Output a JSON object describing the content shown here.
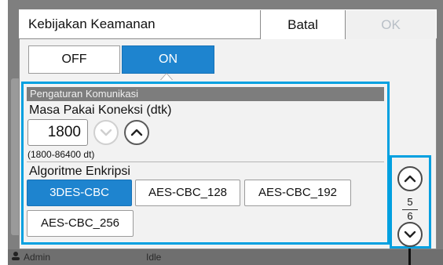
{
  "colors": {
    "accent": "#1e84cf",
    "highlight": "#00a0e0",
    "dim": "#7f7f7f"
  },
  "background": {
    "user": "Admin",
    "status": "Idle"
  },
  "dialog": {
    "title": "Kebijakan Keamanan",
    "cancel_label": "Batal",
    "ok_label": "OK",
    "toggle": {
      "off_label": "OFF",
      "on_label": "ON",
      "selected": "ON"
    }
  },
  "section": {
    "header": "Pengaturan Komunikasi",
    "connection": {
      "label": "Masa Pakai Koneksi (dtk)",
      "value": "1800",
      "range": "(1800-86400 dt)"
    },
    "encryption": {
      "label": "Algoritme Enkripsi",
      "options": [
        "3DES-CBC",
        "AES-CBC_128",
        "AES-CBC_192",
        "AES-CBC_256"
      ],
      "selected": "3DES-CBC"
    }
  },
  "pager": {
    "current": "5",
    "total": "6"
  }
}
